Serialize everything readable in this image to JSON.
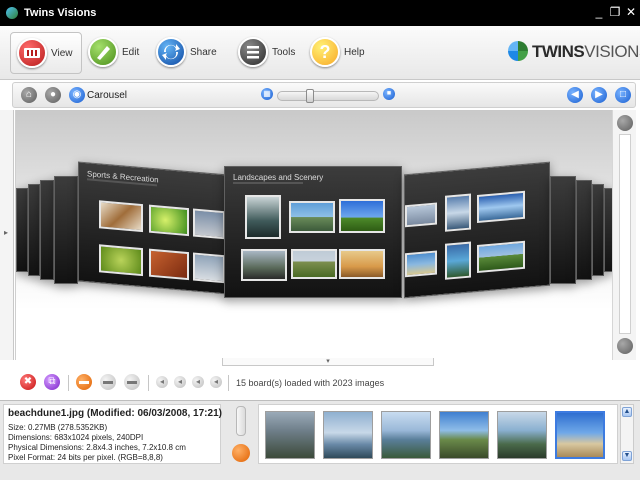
{
  "window": {
    "title": "Twins Visions",
    "minimize_glyph": "_",
    "restore_glyph": "❐",
    "close_glyph": "✕"
  },
  "ribbon": {
    "buttons": [
      {
        "label": "View",
        "icon": "film-icon",
        "color": "#d32f2f"
      },
      {
        "label": "Edit",
        "icon": "brush-icon",
        "color": "#6ab42f"
      },
      {
        "label": "Share",
        "icon": "share-arrows-icon",
        "color": "#1e88e5"
      },
      {
        "label": "Tools",
        "icon": "tools-list-icon",
        "color": "#424242"
      },
      {
        "label": "Help",
        "icon": "help-icon",
        "color": "#fbc02d"
      }
    ],
    "help_glyph": "?",
    "brand": {
      "name_bold": "TWINS",
      "name_light": "VISIONS"
    }
  },
  "viewer_toolbar": {
    "mode_label": "Carousel",
    "home_glyph": "⌂",
    "record_glyph": "●",
    "carousel_glyph": "◉",
    "slider_min_glyph": "▦",
    "slider_max_glyph": "■",
    "back_glyph": "◀",
    "forward_glyph": "▶",
    "fullscreen_glyph": "□",
    "zoom_level": 0.3
  },
  "carousel": {
    "boards": [
      {
        "title": "Sports & Recreation"
      },
      {
        "title": "Landscapes and Scenery"
      }
    ],
    "left_handle_glyph": "▸",
    "pull_tab_glyph": "▾"
  },
  "action_bar": {
    "delete_glyph": "✖",
    "duplicate_glyph": "⧉",
    "board_glyph": "▬",
    "light_glyph": "▬",
    "mini_glyph": "◂",
    "status": "15 board(s) loaded with 2023 images"
  },
  "file_info": {
    "name_line": "beachdune1.jpg (Modified:  06/03/2008, 17:21)",
    "size": "Size: 0.27MB (278.5352KB)",
    "dimensions": "Dimensions: 683x1024 pixels, 240DPI",
    "physical": "Physical Dimensions: 2.8x4.3 inches, 7.2x10.8 cm",
    "pixel_format": "Pixel Format: 24 bits per pixel. (RGB=8,8,8)"
  },
  "scroll": {
    "up_glyph": "▲",
    "down_glyph": "▼"
  },
  "colors": {
    "accent_blue": "#1a5fd1",
    "board_dark": "#1a1a1a",
    "titlebar": "#000000"
  }
}
